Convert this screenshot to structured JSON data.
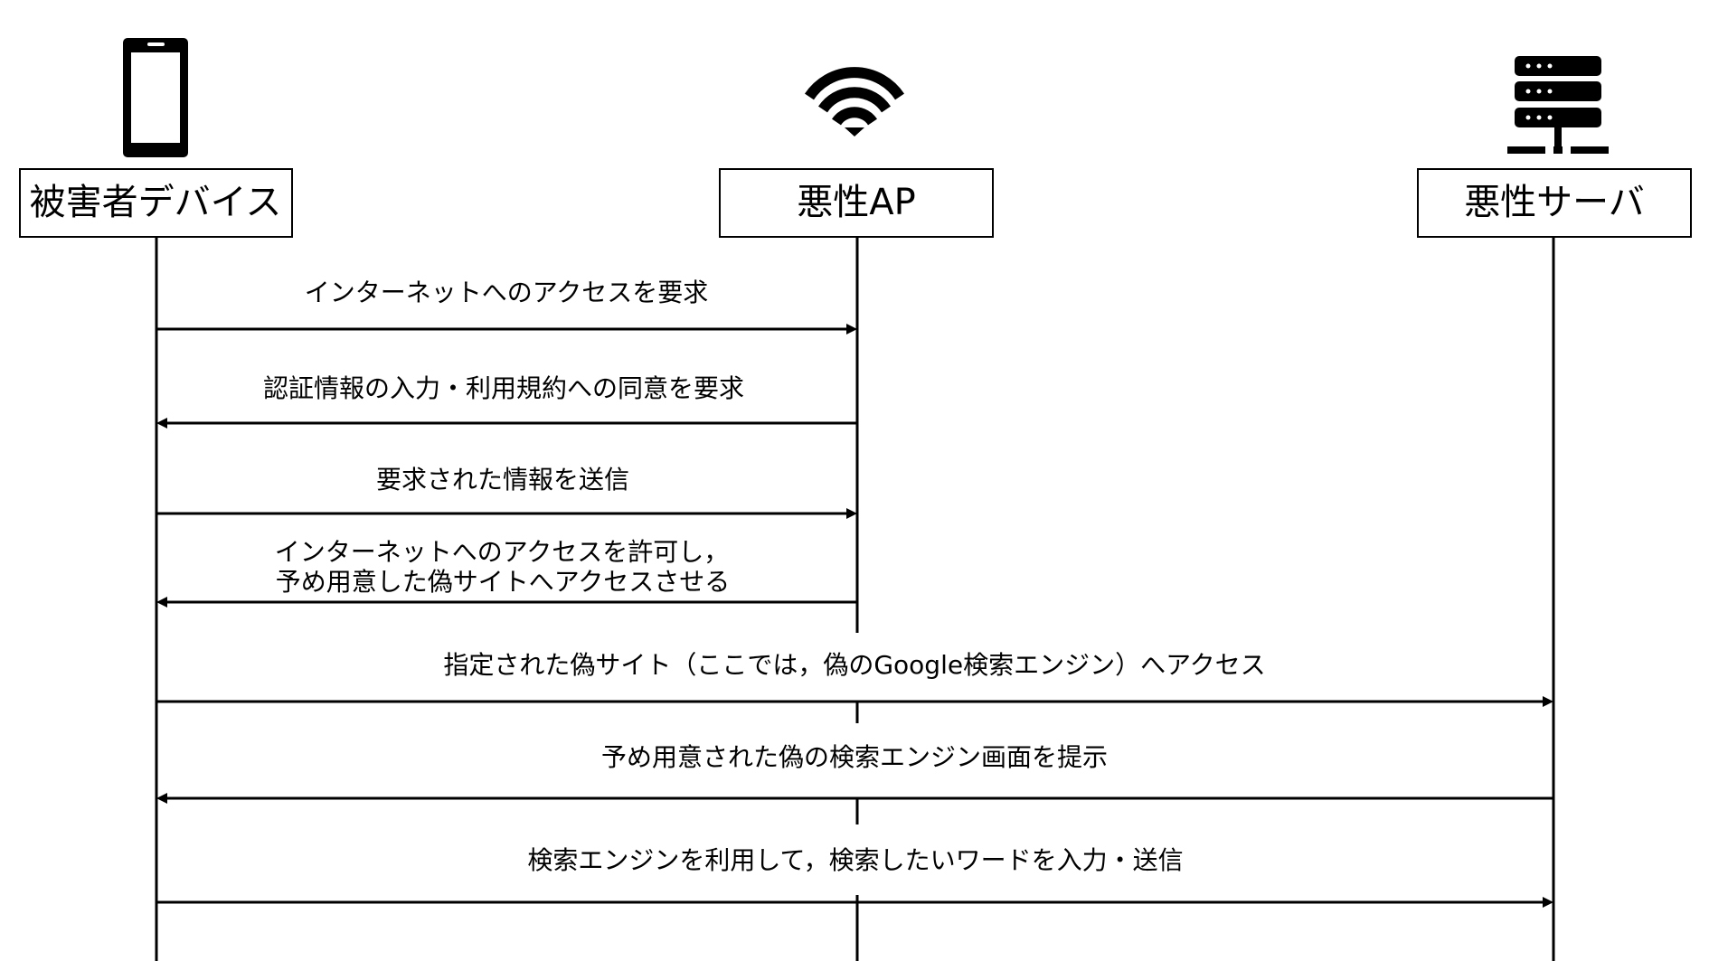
{
  "actors": [
    {
      "id": "victim",
      "label": "被害者デバイス",
      "icon": "smartphone-icon"
    },
    {
      "id": "ap",
      "label": "悪性AP",
      "icon": "wifi-icon"
    },
    {
      "id": "server",
      "label": "悪性サーバ",
      "icon": "server-icon"
    }
  ],
  "messages": [
    {
      "from": "victim",
      "to": "ap",
      "lines": [
        "インターネットへのアクセスを要求"
      ]
    },
    {
      "from": "ap",
      "to": "victim",
      "lines": [
        "認証情報の入力・利用規約への同意を要求"
      ]
    },
    {
      "from": "victim",
      "to": "ap",
      "lines": [
        "要求された情報を送信"
      ]
    },
    {
      "from": "ap",
      "to": "victim",
      "lines": [
        "インターネットへのアクセスを許可し，",
        "予め用意した偽サイトへアクセスさせる"
      ]
    },
    {
      "from": "victim",
      "to": "server",
      "lines": [
        "指定された偽サイト（ここでは，偽のGoogle検索エンジン）へアクセス"
      ]
    },
    {
      "from": "server",
      "to": "victim",
      "lines": [
        "予め用意された偽の検索エンジン画面を提示"
      ]
    },
    {
      "from": "victim",
      "to": "server",
      "lines": [
        "検索エンジンを利用して，検索したいワードを入力・送信"
      ]
    }
  ]
}
